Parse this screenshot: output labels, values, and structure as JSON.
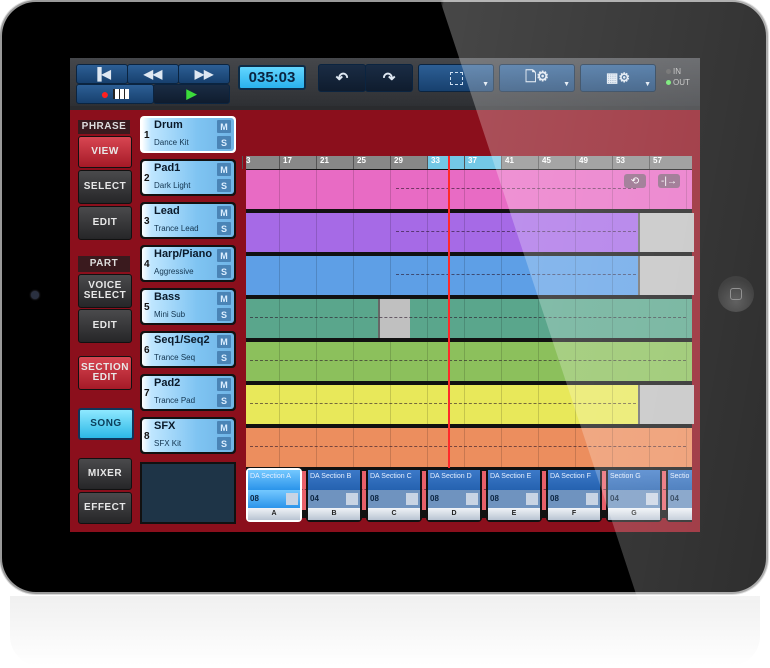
{
  "transport": {
    "rewind_start_icon": "skip-to-start-icon",
    "rewind_icon": "rewind-icon",
    "fastforward_icon": "fast-forward-icon",
    "record_icon": "record-icon",
    "keyboard_icon": "piano-keyboard-icon",
    "play_icon": "play-icon",
    "time": "035:03"
  },
  "toolbar": {
    "undo_icon": "undo-icon",
    "redo_icon": "redo-icon",
    "select_region_icon": "dashed-selection-icon",
    "file_settings_icon": "document-gear-icon",
    "song_settings_icon": "grid-gear-icon",
    "in_label": "IN",
    "out_label": "OUT"
  },
  "sidebar": {
    "phrase_header": "PHRASE",
    "view": "VIEW",
    "select": "SELECT",
    "phrase_edit": "EDIT",
    "part_header": "PART",
    "voice_select": "VOICE SELECT",
    "part_edit": "EDIT",
    "section_edit": "SECTION EDIT",
    "song": "SONG",
    "mixer": "MIXER",
    "effect": "EFFECT"
  },
  "tracks": [
    {
      "num": "1",
      "name": "Drum",
      "voice": "Dance Kit",
      "m": "M",
      "s": "S",
      "color": "#e86bc4"
    },
    {
      "num": "2",
      "name": "Pad1",
      "voice": "Dark Light",
      "m": "M",
      "s": "S",
      "color": "#a66ae6"
    },
    {
      "num": "3",
      "name": "Lead",
      "voice": "Trance Lead",
      "m": "M",
      "s": "S",
      "color": "#5e9fe6"
    },
    {
      "num": "4",
      "name": "Harp/Piano",
      "voice": "Aggressive",
      "m": "M",
      "s": "S",
      "color": "#5aa68c"
    },
    {
      "num": "5",
      "name": "Bass",
      "voice": "Mini Sub",
      "m": "M",
      "s": "S",
      "color": "#8cc05c"
    },
    {
      "num": "6",
      "name": "Seq1/Seq2",
      "voice": "Trance Seq",
      "m": "M",
      "s": "S",
      "color": "#e8e85a"
    },
    {
      "num": "7",
      "name": "Pad2",
      "voice": "Trance Pad",
      "m": "M",
      "s": "S",
      "color": "#ec8e5e"
    },
    {
      "num": "8",
      "name": "SFX",
      "voice": "SFX Kit",
      "m": "M",
      "s": "S",
      "color": "#e8606a"
    }
  ],
  "ruler": [
    "3",
    "17",
    "21",
    "25",
    "29",
    "33",
    "37",
    "41",
    "45",
    "49",
    "53",
    "57"
  ],
  "lane_buttons": {
    "loop_icon": "loop-icon",
    "split_icon": "split-arrow-icon"
  },
  "sections": [
    {
      "name": "DA Section A",
      "length": "08",
      "key": "A",
      "selected": true
    },
    {
      "name": "DA Section B",
      "length": "04",
      "key": "B"
    },
    {
      "name": "DA Section C",
      "length": "08",
      "key": "C"
    },
    {
      "name": "DA Section D",
      "length": "08",
      "key": "D"
    },
    {
      "name": "DA Section E",
      "length": "08",
      "key": "E"
    },
    {
      "name": "DA Section F",
      "length": "08",
      "key": "F"
    },
    {
      "name": "Section G",
      "length": "04",
      "key": "G"
    },
    {
      "name": "Sectio",
      "length": "04",
      "key": ""
    }
  ]
}
